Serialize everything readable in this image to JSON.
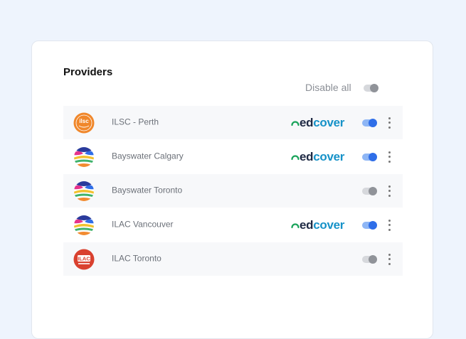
{
  "providers": {
    "title": "Providers",
    "disable_all_label": "Disable all",
    "disable_all_enabled": false,
    "items": [
      {
        "name": "ILSC - Perth",
        "logo": "ilsc-logo",
        "logo_text": "ilsc",
        "edcover": true,
        "enabled": true
      },
      {
        "name": "Bayswater Calgary",
        "logo": "bayswater-logo",
        "edcover": true,
        "enabled": true
      },
      {
        "name": "Bayswater Toronto",
        "logo": "bayswater-logo",
        "edcover": false,
        "enabled": false
      },
      {
        "name": "ILAC Vancouver",
        "logo": "bayswater-logo",
        "edcover": true,
        "enabled": true
      },
      {
        "name": "ILAC Toronto",
        "logo": "ilac-logo",
        "logo_text": "ILAC",
        "edcover": false,
        "enabled": false
      }
    ],
    "edcover_brand": {
      "part1": "ed",
      "part2": "cover"
    }
  },
  "colors": {
    "background": "#eef4fd",
    "toggle_on": "#2f6ee8",
    "toggle_off": "#909399",
    "edcover_dark": "#1f2a44",
    "edcover_blue": "#1692c8",
    "edcover_green": "#1aa35a",
    "ilsc_orange": "#f0872b",
    "ilac_red": "#d9412f"
  }
}
